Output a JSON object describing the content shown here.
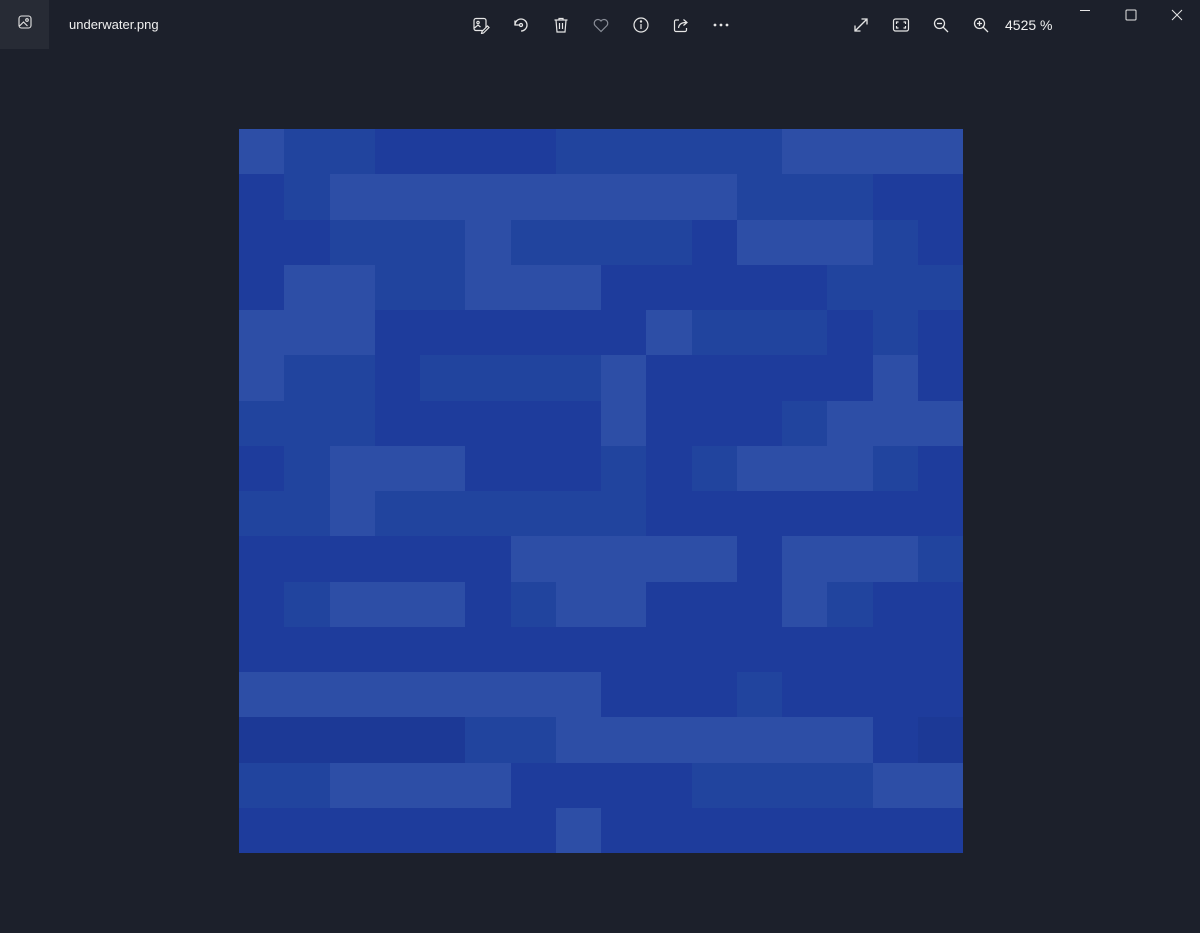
{
  "window": {
    "filename": "underwater.png",
    "zoom_label": "4525 %"
  },
  "toolbar": {
    "items": [
      {
        "name": "edit-image-icon",
        "label": "Edit image"
      },
      {
        "name": "rotate-icon",
        "label": "Rotate"
      },
      {
        "name": "delete-icon",
        "label": "Delete"
      },
      {
        "name": "favorite-icon",
        "label": "Favorite"
      },
      {
        "name": "info-icon",
        "label": "File info"
      },
      {
        "name": "share-icon",
        "label": "Share"
      },
      {
        "name": "more-icon",
        "label": "See more"
      }
    ],
    "view_items": [
      {
        "name": "full-screen-icon",
        "label": "Full screen"
      },
      {
        "name": "fit-to-window-icon",
        "label": "Fit to window"
      },
      {
        "name": "zoom-out-icon",
        "label": "Zoom out"
      },
      {
        "name": "zoom-in-icon",
        "label": "Zoom in"
      }
    ]
  },
  "window_controls": [
    "minimize-icon",
    "maximize-icon",
    "close-icon"
  ],
  "colors": {
    "background": "#1c202b",
    "palette": {
      "d": "#1e3c9c",
      "m": "#21449e",
      "l": "#2d4ea6",
      "k": "#1c3996"
    }
  },
  "image_pixels": [
    "lmmddddmmmmmllll",
    "dmlllllllllmmmdd",
    "ddmmmlmmmmdlllmd",
    "dllmmllldddddmmm",
    "lllddddddlmmmdmd",
    "lmmdmmmmldddddld",
    "mmmdddddldddmllll",
    "dmllldddmdmlllmdd",
    "mmlmmmmmmddddddd",
    "ddddddllllldlllmm",
    "dmllldmlldddlmddd",
    "dddddddddddddddd",
    "lllllllldddmdddd",
    "kkkkkmmllllllldk",
    "mmllllddddmmmmll",
    "dddddddldddddddd"
  ]
}
